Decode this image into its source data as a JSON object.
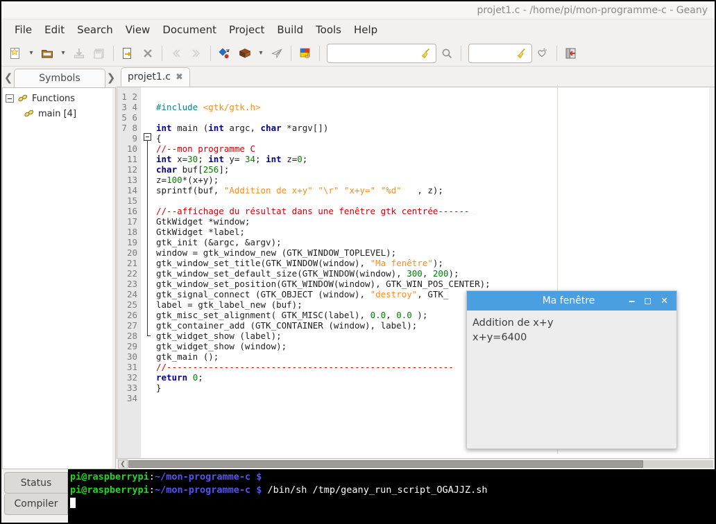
{
  "window": {
    "title": "projet1.c - /home/pi/mon-programme-c - Geany"
  },
  "menubar": {
    "items": [
      {
        "label": "File"
      },
      {
        "label": "Edit"
      },
      {
        "label": "Search"
      },
      {
        "label": "View"
      },
      {
        "label": "Document"
      },
      {
        "label": "Project"
      },
      {
        "label": "Build"
      },
      {
        "label": "Tools"
      },
      {
        "label": "Help"
      }
    ]
  },
  "toolbar": {
    "new_icon": "new-document-icon",
    "new_dropdown_icon": "chevron-down-icon",
    "open_icon": "open-folder-icon",
    "open_dropdown_icon": "chevron-down-icon",
    "save_icon": "save-icon",
    "save_all_icon": "save-all-icon",
    "reload_icon": "reload-icon",
    "close_icon": "close-document-icon",
    "back_icon": "navigate-back-icon",
    "forward_icon": "navigate-forward-icon",
    "compile_icon": "compile-icon",
    "build_icon": "build-brick-icon",
    "build_dropdown_icon": "chevron-down-icon",
    "run_icon": "run-paperplane-icon",
    "color_picker_icon": "color-chooser-icon",
    "search_clear_icon": "broom-clear-icon",
    "search_find_icon": "magnifier-icon",
    "goto_clear_icon": "broom-clear-icon",
    "goto_jump_icon": "jump-to-icon",
    "quit_icon": "quit-door-icon",
    "search_value": "",
    "search_placeholder": "",
    "goto_value": "",
    "goto_placeholder": ""
  },
  "sidebar": {
    "prev_icon": "chevron-left-icon",
    "next_icon": "chevron-right-icon",
    "tab_label": "Symbols",
    "tree": [
      {
        "label": "Functions",
        "level": 0,
        "icon": "chain-link-icon",
        "expanded": true
      },
      {
        "label": "main [4]",
        "level": 1,
        "icon": "chain-link-icon",
        "expanded": false
      }
    ]
  },
  "editor": {
    "tab_label": "projet1.c",
    "tab_close_icon": "close-tab-icon",
    "line_count": 34,
    "lines": [
      {
        "n": 1,
        "text": ""
      },
      {
        "n": 2,
        "text": "#include <gtk/gtk.h>"
      },
      {
        "n": 3,
        "text": ""
      },
      {
        "n": 4,
        "text": "int main (int argc, char *argv[])"
      },
      {
        "n": 5,
        "text": "{"
      },
      {
        "n": 6,
        "text": "//--mon programme C"
      },
      {
        "n": 7,
        "text": "int x=30; int y= 34; int z=0;"
      },
      {
        "n": 8,
        "text": "char buf[256];"
      },
      {
        "n": 9,
        "text": "z=100*(x+y);"
      },
      {
        "n": 10,
        "text": "sprintf(buf, \"Addition de x+y\" \"\\r\" \"x+y=\" \"%d\"   , z);"
      },
      {
        "n": 11,
        "text": ""
      },
      {
        "n": 12,
        "text": "//--affichage du résultat dans une fenêtre gtk centrée------"
      },
      {
        "n": 13,
        "text": "GtkWidget *window;"
      },
      {
        "n": 14,
        "text": "GtkWidget *label;"
      },
      {
        "n": 15,
        "text": "gtk_init (&argc, &argv);"
      },
      {
        "n": 16,
        "text": "window = gtk_window_new (GTK_WINDOW_TOPLEVEL);"
      },
      {
        "n": 17,
        "text": "gtk_window_set_title(GTK_WINDOW(window), \"Ma fenêtre\");"
      },
      {
        "n": 18,
        "text": "gtk_window_set_default_size(GTK_WINDOW(window), 300, 200);"
      },
      {
        "n": 19,
        "text": "gtk_window_set_position(GTK_WINDOW(window), GTK_WIN_POS_CENTER);"
      },
      {
        "n": 20,
        "text": "gtk_signal_connect (GTK_OBJECT (window), \"destroy\", GTK_"
      },
      {
        "n": 21,
        "text": "label = gtk_label_new (buf);"
      },
      {
        "n": 22,
        "text": "gtk_misc_set_alignment( GTK_MISC(label), 0.0, 0.0 );"
      },
      {
        "n": 23,
        "text": "gtk_container_add (GTK_CONTAINER (window), label);"
      },
      {
        "n": 24,
        "text": "gtk_widget_show (label);"
      },
      {
        "n": 25,
        "text": "gtk_widget_show (window);"
      },
      {
        "n": 26,
        "text": "gtk_main ();"
      },
      {
        "n": 27,
        "text": "//-------------------------------------------------------"
      },
      {
        "n": 28,
        "text": "return 0;"
      },
      {
        "n": 29,
        "text": "}"
      },
      {
        "n": 30,
        "text": ""
      },
      {
        "n": 31,
        "text": ""
      },
      {
        "n": 32,
        "text": ""
      },
      {
        "n": 33,
        "text": ""
      },
      {
        "n": 34,
        "text": ""
      }
    ],
    "hscroll_left_icon": "scroll-left-icon"
  },
  "gtk_window": {
    "title": "Ma fenêtre",
    "minimize_icon": "minimize-icon",
    "maximize_icon": "maximize-icon",
    "close_icon": "close-icon",
    "line1": "Addition de x+y",
    "line2": "x+y=6400"
  },
  "message_panel": {
    "tabs": [
      {
        "label": "Status",
        "active": true
      },
      {
        "label": "Compiler",
        "active": false
      }
    ],
    "terminal": {
      "lines": [
        {
          "user": "pi@raspberrypi",
          "sep": ":",
          "path": "~/mon-programme-c",
          "prompt": "$",
          "command": ""
        },
        {
          "user": "pi@raspberrypi",
          "sep": ":",
          "path": "~/mon-programme-c",
          "prompt": "$",
          "command": " /bin/sh /tmp/geany_run_script_OGAJJZ.sh"
        }
      ]
    }
  },
  "colors": {
    "gtk_titlebar": "#4a9fe0",
    "terminal_bg": "#000000",
    "terminal_user": "#24d624",
    "terminal_path": "#5555f0",
    "comment": "#d00000",
    "keyword": "#00008b",
    "string": "#ff8c1a",
    "number": "#008000",
    "preprocessor": "#008b8b",
    "edge_marker": "#c8e6c9"
  }
}
